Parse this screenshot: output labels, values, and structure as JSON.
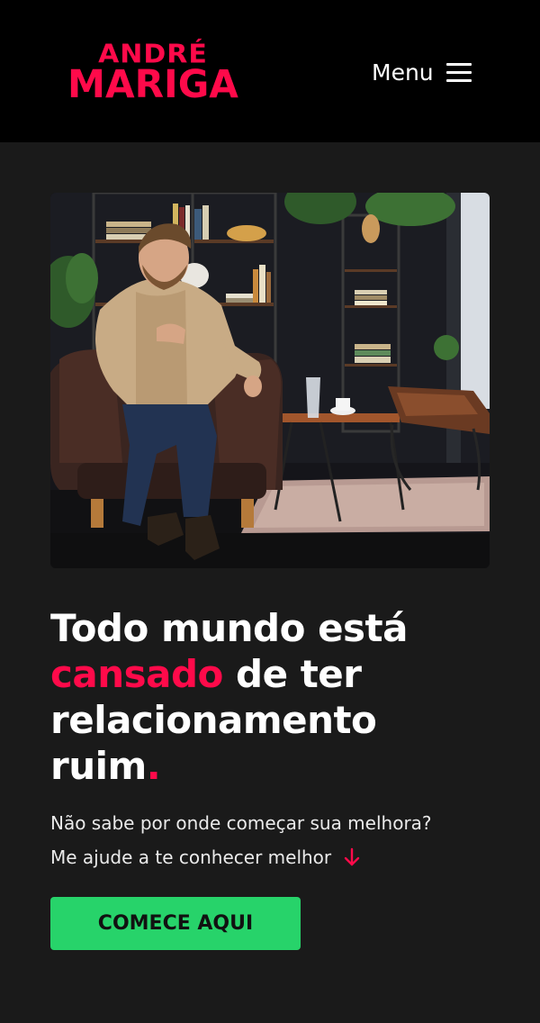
{
  "header": {
    "logo": {
      "line1": "ANDRÉ",
      "line2": "MARIGA"
    },
    "menu_label": "Menu"
  },
  "hero": {
    "headline": {
      "part1": "Todo mundo está",
      "accent_word": "cansado",
      "part2": " de ter",
      "part3": "relacionamento",
      "part4": "ruim",
      "period": "."
    },
    "subtitle_1": "Não sabe por onde começar sua melhora?",
    "subtitle_2": "Me ajude a te conhecer melhor",
    "cta_label": "COMECE AQUI"
  },
  "colors": {
    "background": "#1a1a1a",
    "header": "#000000",
    "accent": "#ff0a4a",
    "cta": "#27d36a"
  },
  "icons": {
    "menu": "hamburger-icon",
    "arrow": "arrow-down-icon"
  }
}
